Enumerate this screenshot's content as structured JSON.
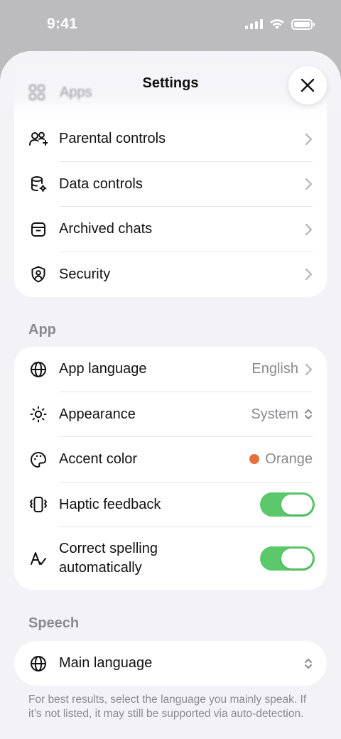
{
  "status_bar": {
    "time": "9:41",
    "icons": [
      "signal-icon",
      "wifi-icon",
      "battery-icon"
    ]
  },
  "sheet": {
    "title": "Settings",
    "ghost_item": {
      "label": "Apps",
      "icon": "apps-icon"
    }
  },
  "account_group": {
    "items": [
      {
        "label": "Parental controls",
        "icon": "people-add-icon"
      },
      {
        "label": "Data controls",
        "icon": "database-settings-icon"
      },
      {
        "label": "Archived chats",
        "icon": "archive-icon"
      },
      {
        "label": "Security",
        "icon": "shield-user-icon"
      }
    ]
  },
  "app_section": {
    "title": "App",
    "language": {
      "label": "App language",
      "value": "English"
    },
    "appearance": {
      "label": "Appearance",
      "value": "System"
    },
    "accent": {
      "label": "Accent color",
      "value": "Orange",
      "color": "#e8703a"
    },
    "haptic": {
      "label": "Haptic feedback",
      "enabled": true
    },
    "spelling": {
      "label_line1": "Correct spelling",
      "label_line2": "automatically",
      "enabled": true
    }
  },
  "speech_section": {
    "title": "Speech",
    "main_language": {
      "label": "Main language"
    },
    "footnote": "For best results, select the language you mainly speak. If it’s not listed, it may still be supported via auto-detection."
  },
  "colors": {
    "toggle_on": "#5bc86a",
    "accent_orange": "#e8703a",
    "background": "#f2f2f7"
  }
}
